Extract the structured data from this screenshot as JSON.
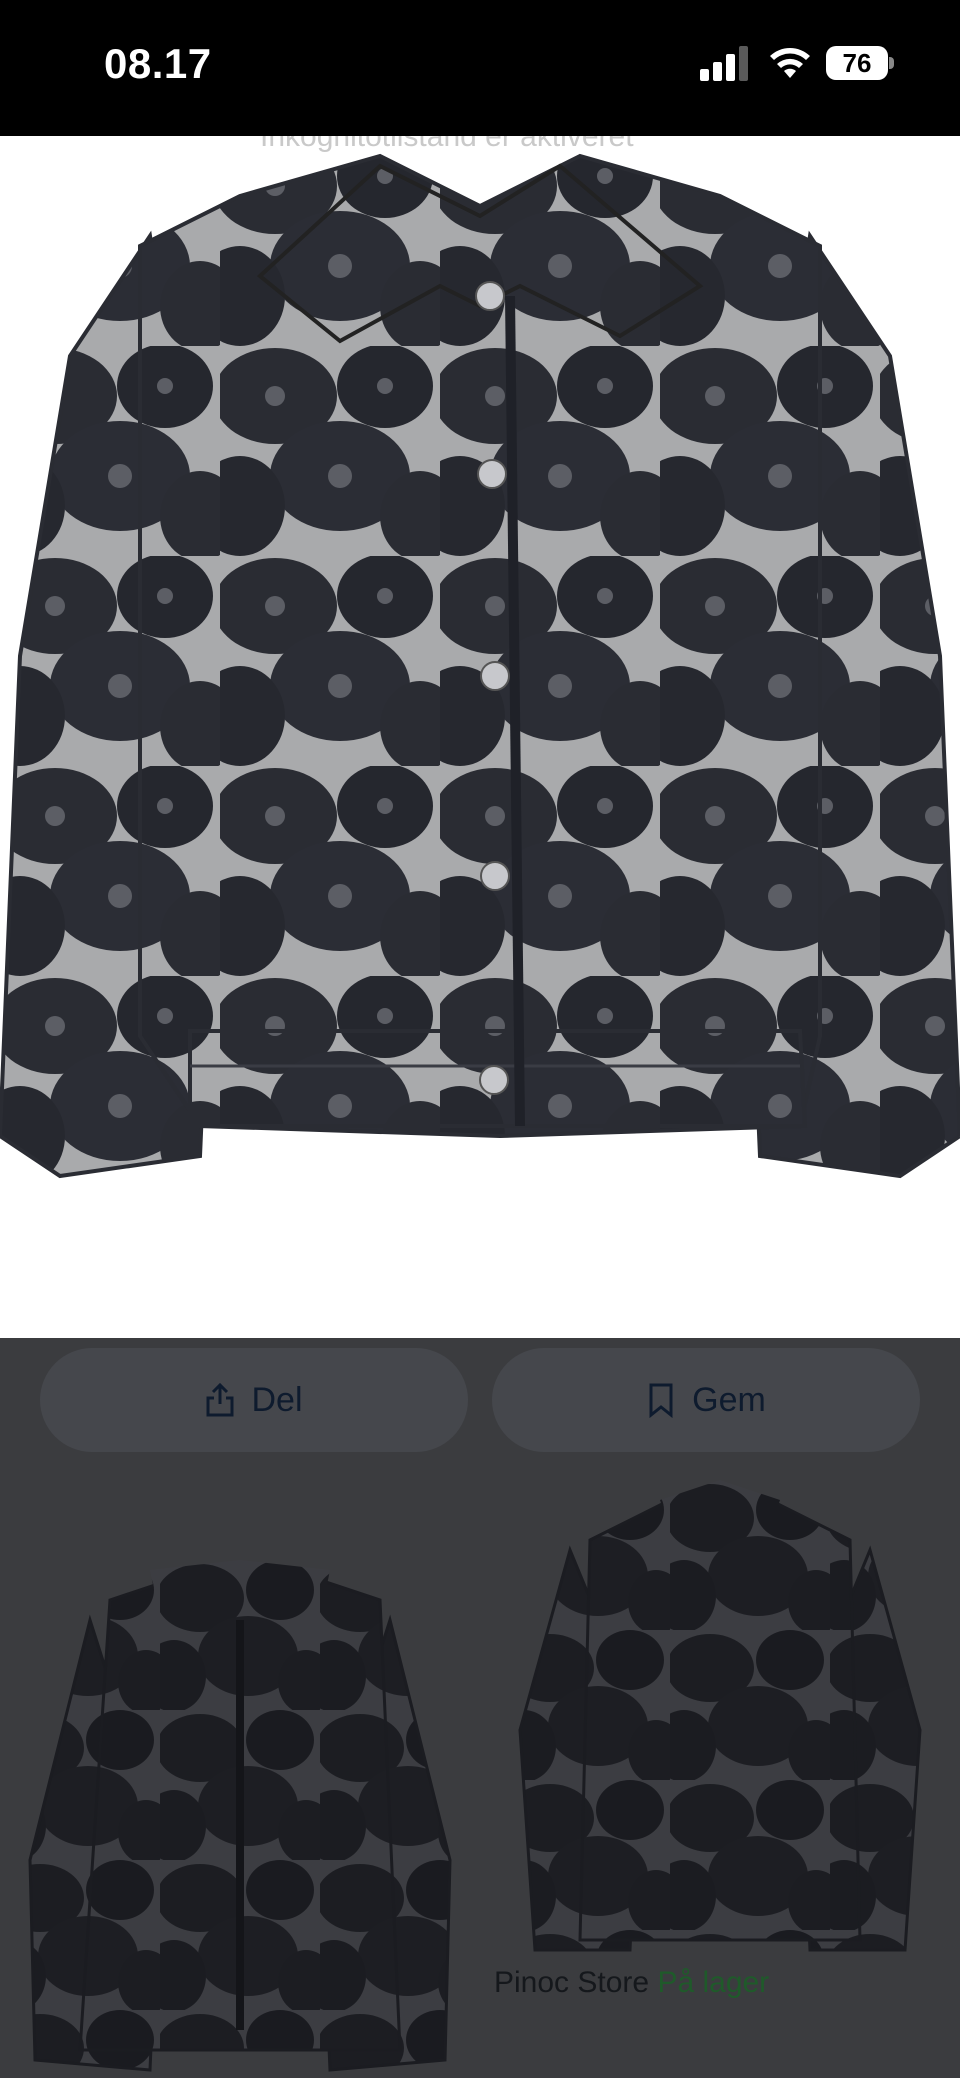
{
  "status_bar": {
    "time": "08.17",
    "battery": "76",
    "icons": [
      "cellular-signal-icon",
      "wifi-icon",
      "battery-icon"
    ]
  },
  "main_image": {
    "behind_text": "Inkognitotilstand er aktiveret",
    "subject": "floral jacquard jacket"
  },
  "actions": {
    "share_label": "Del",
    "save_label": "Gem"
  },
  "related": {
    "store_name": "Pinoc Store",
    "availability": "På lager"
  },
  "colors": {
    "overlay": "#3b3c3f",
    "button_bg": "#45474c",
    "button_text": "#0e1b2e",
    "availability_green": "#1f5a2a"
  }
}
